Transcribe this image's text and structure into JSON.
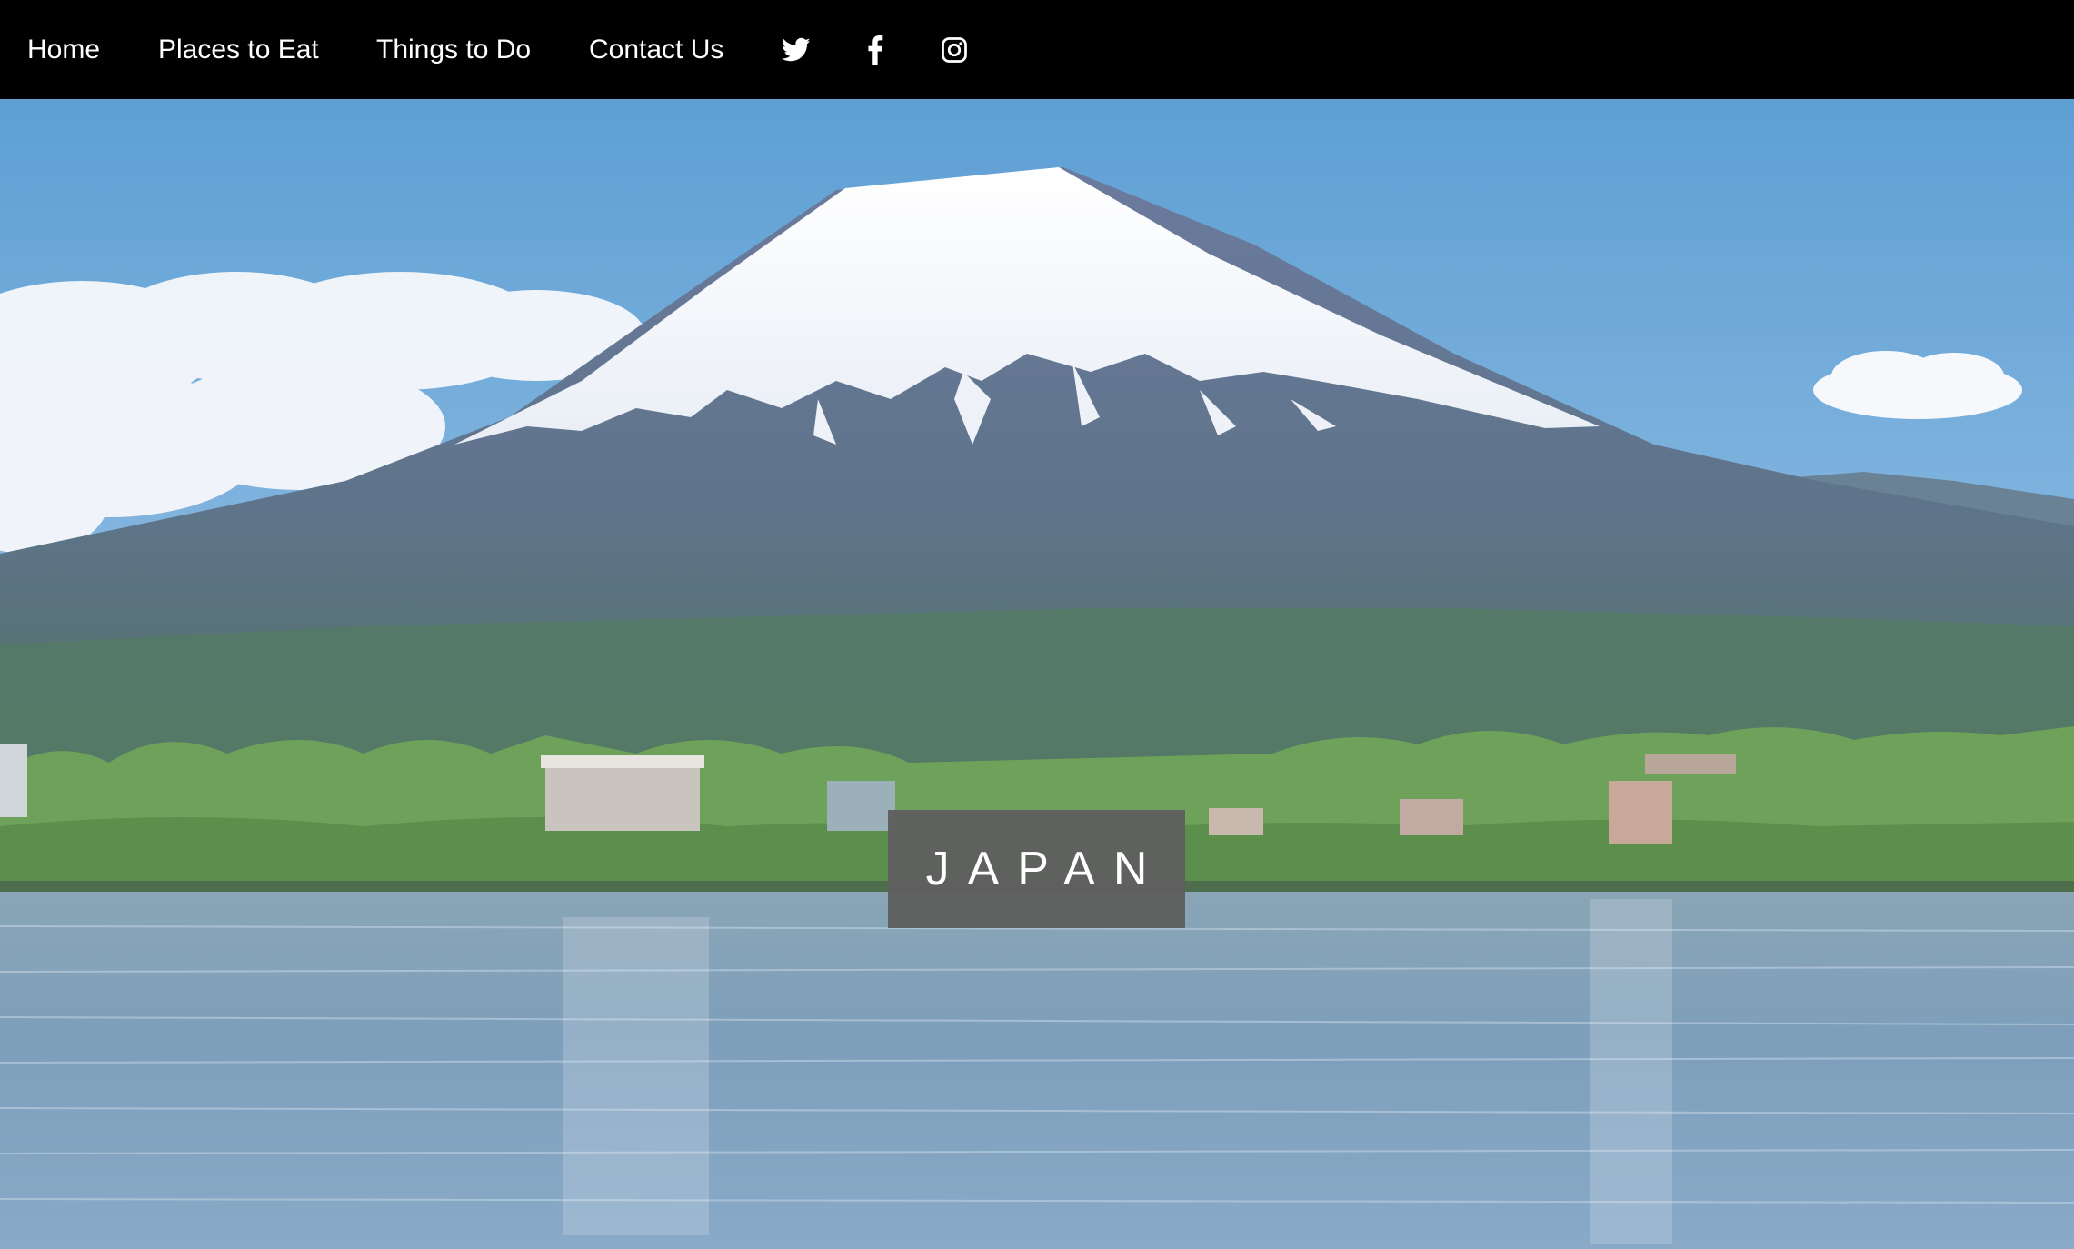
{
  "nav": {
    "links": [
      {
        "label": "Home"
      },
      {
        "label": "Places to Eat"
      },
      {
        "label": "Things to Do"
      },
      {
        "label": "Contact Us"
      }
    ],
    "social_icons": [
      "twitter-icon",
      "facebook-icon",
      "instagram-icon"
    ]
  },
  "hero": {
    "title": "JAPAN",
    "image": "mount-fuji-lake-landscape"
  },
  "colors": {
    "navbar_bg": "#000000",
    "nav_text": "#ffffff",
    "title_box_bg": "#5f5f5f",
    "sky": "#6aa5d8",
    "lake": "#7ea0b8"
  }
}
